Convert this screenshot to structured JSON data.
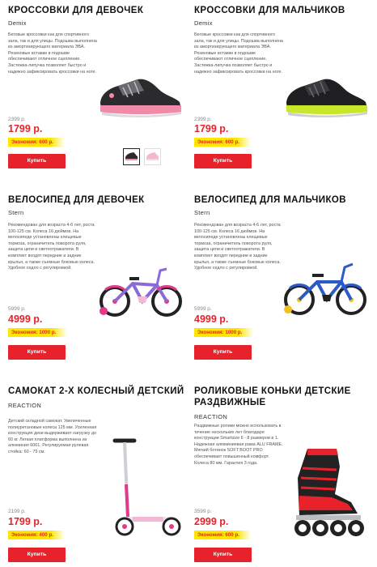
{
  "products": [
    {
      "title": "КРОССОВКИ ДЛЯ ДЕВОЧЕК",
      "brand": "Demix",
      "description": "Беговые кроссовки как для спортивного зала, так и для улицы. Подошва выполнена из амортизирующего материала ЭВА. Резиновые вставки в подошве обеспечивают отличное сцепление. Застежка-липучка позволяет быстро и надежно зафиксировать кроссовки на ноге.",
      "old_price": "2399 р.",
      "price": "1799 р.",
      "savings": "Экономия: 600 р.",
      "buy_label": "Купить",
      "image": "girls-sneaker-image"
    },
    {
      "title": "КРОССОВКИ ДЛЯ МАЛЬЧИКОВ",
      "brand": "Demix",
      "description": "Беговые кроссовки как для спортивного зала, так и для улицы. Подошва выполнена из амортизирующего материала ЭВА. Резиновые вставки в подошве обеспечивают отличное сцепление. Застежка-липучка позволяет быстро и надежно зафиксировать кроссовки на ноге.",
      "old_price": "2399 р.",
      "price": "1799 р.",
      "savings": "Экономия: 600 р.",
      "buy_label": "Купить",
      "image": "boys-sneaker-image"
    },
    {
      "title": "ВЕЛОСИПЕД ДЛЯ ДЕВОЧЕК",
      "brand": "Stern",
      "description": "Рекомендован для возраста 4-6 лет, роста 100-125 см. Колеса 16 дюймов. На велосипеде установлены клещевые тормоза, ограничитель поворота руля, защита цепи и светоотражатели. В комплект входят передние и задние крылья, а также съемные боковые колеса. Удобное седло с регулировкой.",
      "old_price": "5999 р.",
      "price": "4999 р.",
      "savings": "Экономия: 1000 р.",
      "buy_label": "Купить",
      "image": "girls-bike-image"
    },
    {
      "title": "ВЕЛОСИПЕД ДЛЯ МАЛЬЧИКОВ",
      "brand": "Stern",
      "description": "Рекомендован для возраста 4-6 лет, роста 100-125 см. Колеса 16 дюймов. На велосипеде установлены клещевые тормоза, ограничитель поворота руля, защита цепи и светоотражатели. В комплект входят передние и задние крылья, а также съемные боковые колеса. Удобное седло с регулировкой.",
      "old_price": "5999 р.",
      "price": "4999 р.",
      "savings": "Экономия: 1000 р.",
      "buy_label": "Купить",
      "image": "boys-bike-image"
    },
    {
      "title": "САМОКАТ 2-Х КОЛЕСНЫЙ ДЕТСКИЙ",
      "brand": "REACTION",
      "description": "Детский складной самокат. Увеличенные полиуретановые колеса 125 мм. Усиленная конструкция деки выдерживает нагрузку до 60 кг. Легкая платформа выполнена из алюминия 6061. Регулируемая рулевая стойка: 60 - 79 см.",
      "old_price": "2199 р.",
      "price": "1799 р.",
      "savings": "Экономия: 400 р.",
      "buy_label": "Купить",
      "image": "scooter-image"
    },
    {
      "title": "РОЛИКОВЫЕ КОНЬКИ ДЕТСКИЕ РАЗДВИЖНЫЕ",
      "brand": "REACTION",
      "description": "Раздвижные ролики можно использовать в течение нескольких лет благодаря конструкции Smartsize 6 - 8 размеров в 1. Надежная алюминиевая рама ALU FRAME. Мягкий ботинок SOFT BOOT PRO обеспечивает повышенный комфорт. Колеса 80 мм. Гарантия 3 года.",
      "old_price": "3599 р.",
      "price": "2999 р.",
      "savings": "Экономия: 600 р.",
      "buy_label": "Купить",
      "image": "inline-skates-image"
    }
  ],
  "thumbnails": [
    "dark-sneaker-thumbnail",
    "pink-sneaker-thumbnail"
  ]
}
